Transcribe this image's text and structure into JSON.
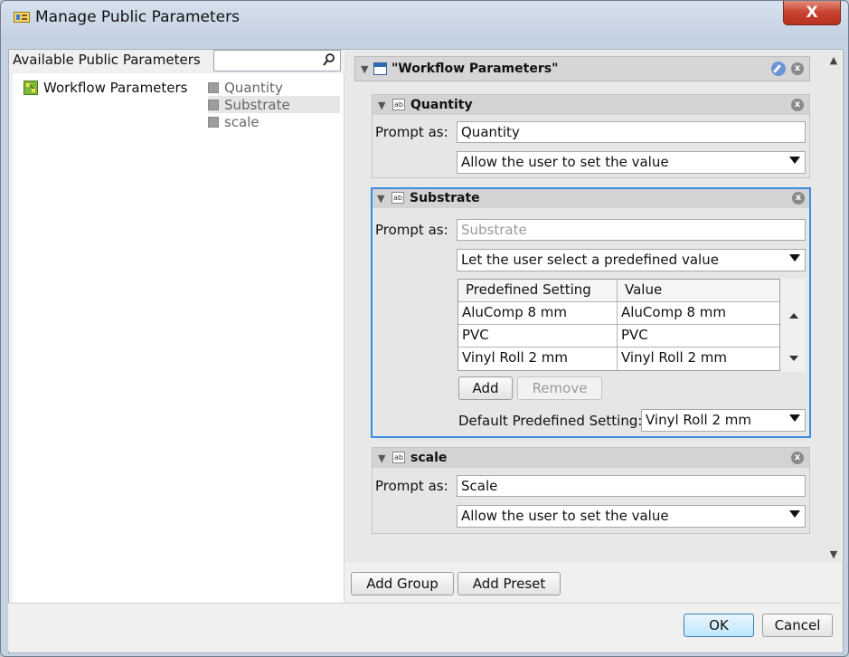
{
  "window": {
    "title": "Manage Public Parameters",
    "close_glyph": "X",
    "title_icon": "dialog-icon"
  },
  "left": {
    "header": "Available Public Parameters",
    "search": {
      "value": "",
      "placeholder": "",
      "icon": "search-icon"
    },
    "tree": [
      {
        "label": "Workflow Parameters",
        "icon": "workflow-icon"
      }
    ],
    "params": [
      {
        "label": "Quantity"
      },
      {
        "label": "Substrate",
        "selected": true
      },
      {
        "label": "scale"
      }
    ]
  },
  "group": {
    "title": "\"Workflow Parameters\"",
    "close_glyph": "x"
  },
  "cards": {
    "quantity": {
      "title": "Quantity",
      "prompt_label": "Prompt as:",
      "prompt_value": "Quantity",
      "mode": "Allow the user to set the value"
    },
    "substrate": {
      "title": "Substrate",
      "prompt_label": "Prompt as:",
      "prompt_placeholder": "Substrate",
      "mode": "Let the user select a predefined value",
      "table": {
        "headers": [
          "Predefined Setting",
          "Value"
        ],
        "rows": [
          [
            "AluComp 8 mm",
            "AluComp 8 mm"
          ],
          [
            "PVC",
            "PVC"
          ],
          [
            "Vinyl Roll 2 mm",
            "Vinyl Roll 2 mm"
          ]
        ]
      },
      "add_label": "Add",
      "remove_label": "Remove",
      "default_label": "Default Predefined Setting:",
      "default_value": "Vinyl Roll 2 mm"
    },
    "scale": {
      "title": "scale",
      "prompt_label": "Prompt as:",
      "prompt_value": "Scale",
      "mode": "Allow the user to set the value"
    }
  },
  "bottom": {
    "add_group": "Add Group",
    "add_preset": "Add Preset"
  },
  "footer": {
    "ok": "OK",
    "cancel": "Cancel"
  },
  "colors": {
    "accent": "#3b8de0",
    "close_red": "#c8412e"
  }
}
